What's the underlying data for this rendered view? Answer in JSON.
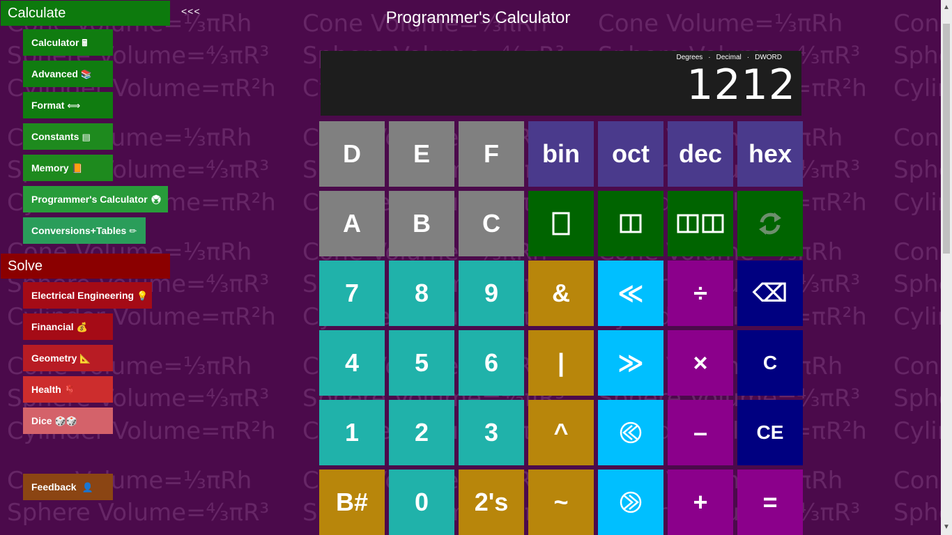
{
  "watermark": {
    "cone": "Cone Volume=⅓πRh",
    "sphere": "Sphere Volume=⁴⁄₃πR³",
    "cylinder": "Cylinder Volume=πR²h"
  },
  "sidebar": {
    "collapse_label": "<<<",
    "calculate": {
      "header": "Calculate",
      "items": [
        {
          "label": "Calculator",
          "icon": "🖩",
          "color": "#107c10"
        },
        {
          "label": "Advanced",
          "icon": "📚",
          "color": "#107c10"
        },
        {
          "label": "Format",
          "icon": "⟺",
          "color": "#107c10"
        },
        {
          "label": "Constants",
          "icon": "▤",
          "color": "#1e8a1e"
        },
        {
          "label": "Memory",
          "icon": "📙",
          "color": "#1e8a1e"
        },
        {
          "label": "Programmer's Calculator",
          "icon": "🖲",
          "color": "#289c3a"
        },
        {
          "label": "Conversions+Tables",
          "icon": "✏",
          "color": "#2a9d5a"
        }
      ]
    },
    "solve": {
      "header": "Solve",
      "items": [
        {
          "label": "Electrical Engineering",
          "icon": "💡",
          "color": "#a50b16"
        },
        {
          "label": "Financial",
          "icon": "💰",
          "color": "#a50b16"
        },
        {
          "label": "Geometry",
          "icon": "📐",
          "color": "#b81c24"
        },
        {
          "label": "Health",
          "icon": "🫀",
          "color": "#cd2d2d"
        },
        {
          "label": "Dice",
          "icon": "🎲🎲",
          "color": "#d4626a"
        }
      ]
    },
    "feedback": {
      "label": "Feedback",
      "icon": "👤",
      "color": "#8b4513"
    }
  },
  "title": "Programmer's Calculator",
  "display": {
    "angle_mode": "Degrees",
    "base_mode": "Decimal",
    "word_size": "DWORD",
    "separator": "·",
    "value": "1212"
  },
  "keys": [
    [
      "D",
      "E",
      "F",
      "bin",
      "oct",
      "dec",
      "hex"
    ],
    [
      "A",
      "B",
      "C",
      "",
      "",
      "",
      ""
    ],
    [
      "7",
      "8",
      "9",
      "&",
      "≪",
      "÷",
      "⌫"
    ],
    [
      "4",
      "5",
      "6",
      "|",
      "≫",
      "×",
      "C"
    ],
    [
      "1",
      "2",
      "3",
      "^",
      "",
      "–",
      "CE"
    ],
    [
      "B#",
      "0",
      "2's",
      "~",
      "",
      "+",
      "="
    ]
  ],
  "colors": {
    "background": "#4b0a4b",
    "hex_digit": "#808080",
    "base": "#4a3a8c",
    "word_size": "#006400",
    "number": "#20b2aa",
    "logic": "#b8860b",
    "shift": "#00bfff",
    "operator": "#8b008b",
    "control": "#000080"
  }
}
